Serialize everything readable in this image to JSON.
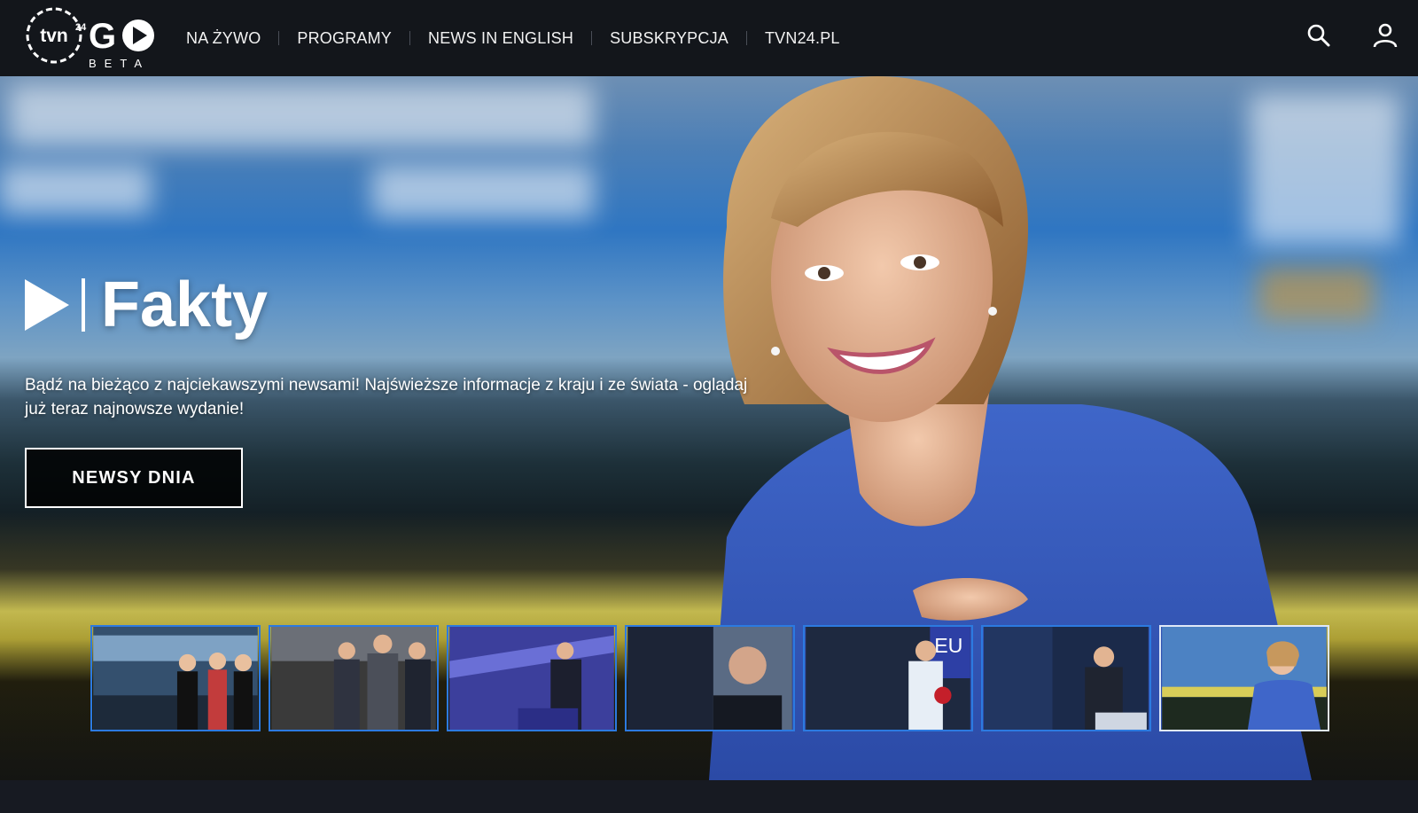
{
  "header": {
    "logo_text": "tvn24 GO",
    "logo_badge": "BETA",
    "nav": [
      {
        "label": "NA ŻYWO"
      },
      {
        "label": "PROGRAMY"
      },
      {
        "label": "NEWS IN ENGLISH"
      },
      {
        "label": "SUBSKRYPCJA"
      },
      {
        "label": "TVN24.PL"
      }
    ],
    "icons": {
      "search": "search-icon",
      "account": "user-icon"
    }
  },
  "hero": {
    "title": "Fakty",
    "description": "Bądź na bieżąco z najciekawszymi newsami! Najświeższe informacje z kraju i ze świata - oglądaj już teraz najnowsze wydanie!",
    "cta_label": "NEWSY DNIA"
  },
  "carousel": {
    "selected_index": 6,
    "count": 7
  },
  "colors": {
    "header_bg": "#13161b",
    "thumb_border": "#2c7ae0",
    "thumb_active_border": "#dfe8f7",
    "page_bg": "#171a22"
  }
}
